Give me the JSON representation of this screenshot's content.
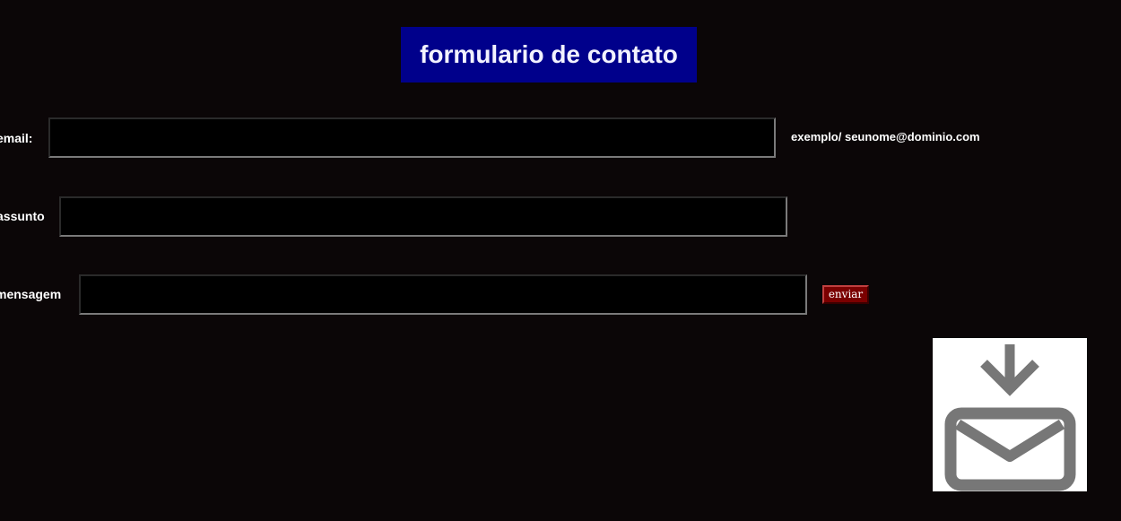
{
  "header": {
    "title": "formulario de contato"
  },
  "form": {
    "email": {
      "label": "email:",
      "value": "",
      "hint": "exemplo/ seunome@dominio.com"
    },
    "subject": {
      "label": "assunto",
      "value": ""
    },
    "message": {
      "label": "mensagem",
      "value": ""
    },
    "submit_label": "enviar"
  },
  "icons": {
    "mail": "mail-download-icon"
  },
  "colors": {
    "background": "#0b0607",
    "title_bg": "#00008b",
    "button_bg": "#7a0000",
    "icon_gray": "#777777"
  }
}
